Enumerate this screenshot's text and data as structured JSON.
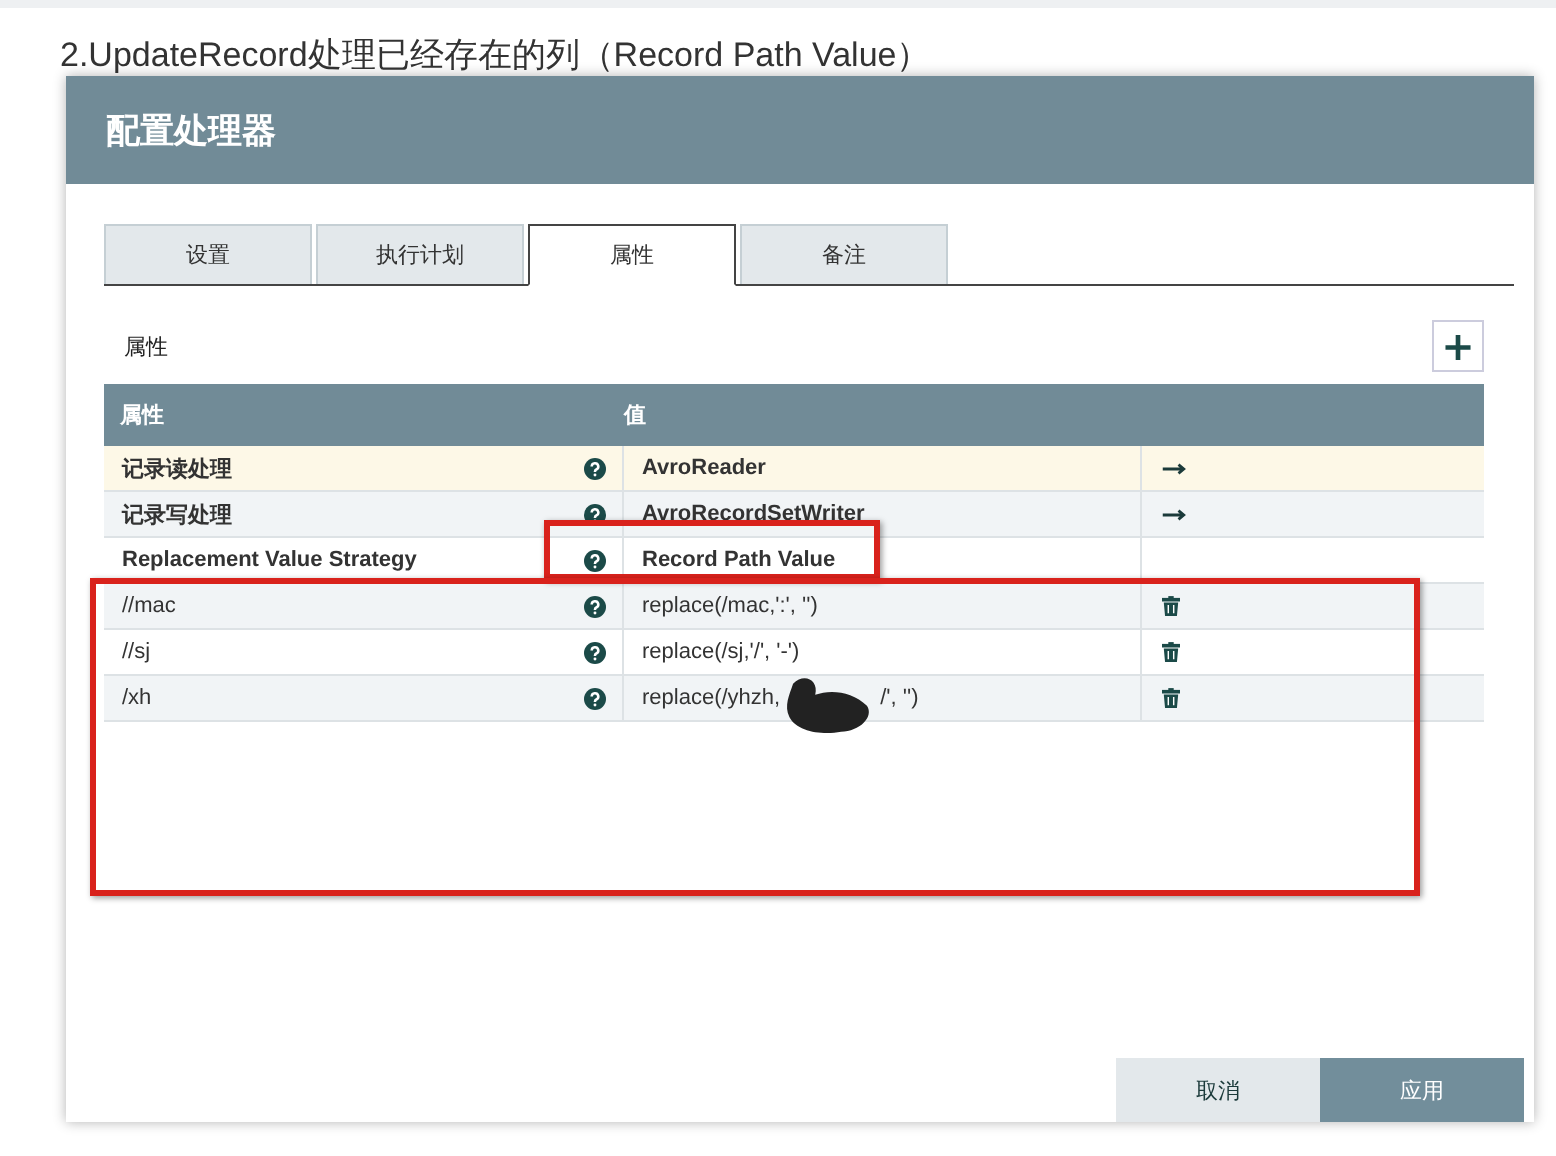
{
  "heading": "2.UpdateRecord处理已经存在的列（Record Path Value）",
  "dialog": {
    "title": "配置处理器",
    "tabs": [
      {
        "label": "设置",
        "selected": false
      },
      {
        "label": "执行计划",
        "selected": false
      },
      {
        "label": "属性",
        "selected": true
      },
      {
        "label": "备注",
        "selected": false
      }
    ],
    "section_label": "属性",
    "add_button": "+",
    "table": {
      "columns": [
        "属性",
        "值"
      ],
      "rows": [
        {
          "kind": "service",
          "name": "记录读处理",
          "value": "AvroReader",
          "selected": true
        },
        {
          "kind": "service",
          "name": "记录写处理",
          "value": "AvroRecordSetWriter",
          "selected": false
        },
        {
          "kind": "plain",
          "name": "Replacement Value Strategy",
          "value": "Record Path Value",
          "selected": false
        },
        {
          "kind": "dynamic",
          "name": "//mac",
          "value": "replace(/mac,':', '')",
          "selected": false
        },
        {
          "kind": "dynamic",
          "name": "//sj",
          "value": "replace(/sj,'/', '-')",
          "selected": false
        },
        {
          "kind": "dynamic",
          "name": "/xh",
          "value": "replace(/yhzh,",
          "value_tail": "/', '')",
          "redacted": true,
          "selected": false
        }
      ]
    },
    "red_boxes": [
      {
        "kind": "value-cell"
      },
      {
        "kind": "dynamic-rows"
      }
    ],
    "buttons": [
      {
        "kind": "secondary",
        "label": "取消"
      },
      {
        "kind": "primary",
        "label": "应用"
      }
    ]
  }
}
